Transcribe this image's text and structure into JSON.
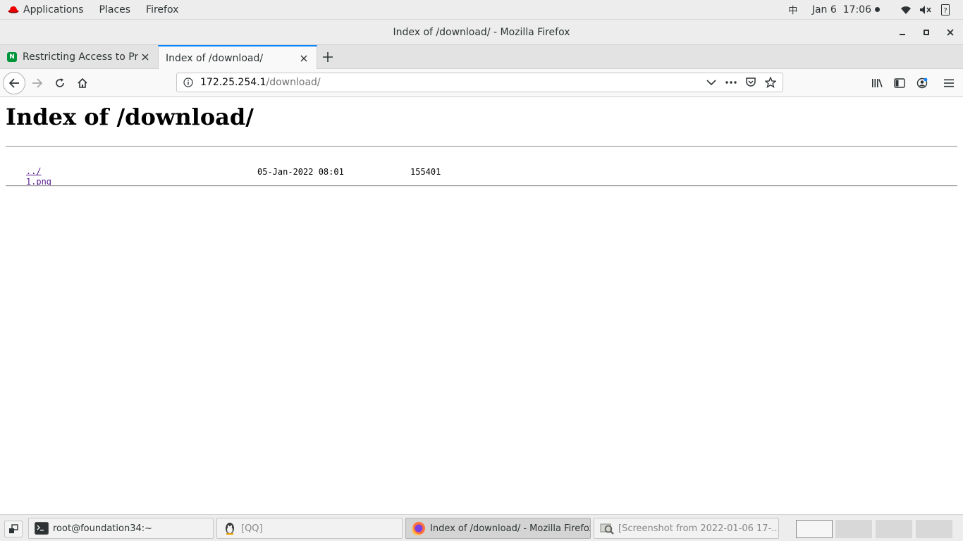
{
  "topbar": {
    "applications_label": "Applications",
    "places_label": "Places",
    "firefox_label": "Firefox",
    "input_method": "中",
    "clock": "Jan 6  17:06",
    "tray_icons": [
      "wifi-icon",
      "volume-muted-icon",
      "help-icon"
    ]
  },
  "window": {
    "title": "Index of /download/ - Mozilla Firefox"
  },
  "tabs": [
    {
      "label": "Restricting Access to Proxied HTTP Resources",
      "favicon": "N",
      "active": false
    },
    {
      "label": "Index of /download/",
      "active": true
    }
  ],
  "urlbar": {
    "host": "172.25.254.1",
    "path": "/download/"
  },
  "page": {
    "heading": "Index of /download/",
    "entries": [
      {
        "name": "../",
        "date": "",
        "size": ""
      },
      {
        "name": "1.png",
        "date": "05-Jan-2022 08:01",
        "size": "155401"
      }
    ]
  },
  "taskbar": {
    "tasks": [
      {
        "label": "root@foundation34:~",
        "icon": "terminal-icon"
      },
      {
        "label": "[QQ]",
        "icon": "qq-penguin-icon"
      },
      {
        "label": "Index of /download/ - Mozilla Firefox",
        "icon": "firefox-icon"
      },
      {
        "label": "[Screenshot from 2022-01-06 17-...",
        "icon": "image-viewer-icon"
      }
    ]
  },
  "colors": {
    "accent": "#0a84ff",
    "link_visited": "#551a8b",
    "redhat": "#ee0000",
    "nginx_green": "#00953b"
  }
}
